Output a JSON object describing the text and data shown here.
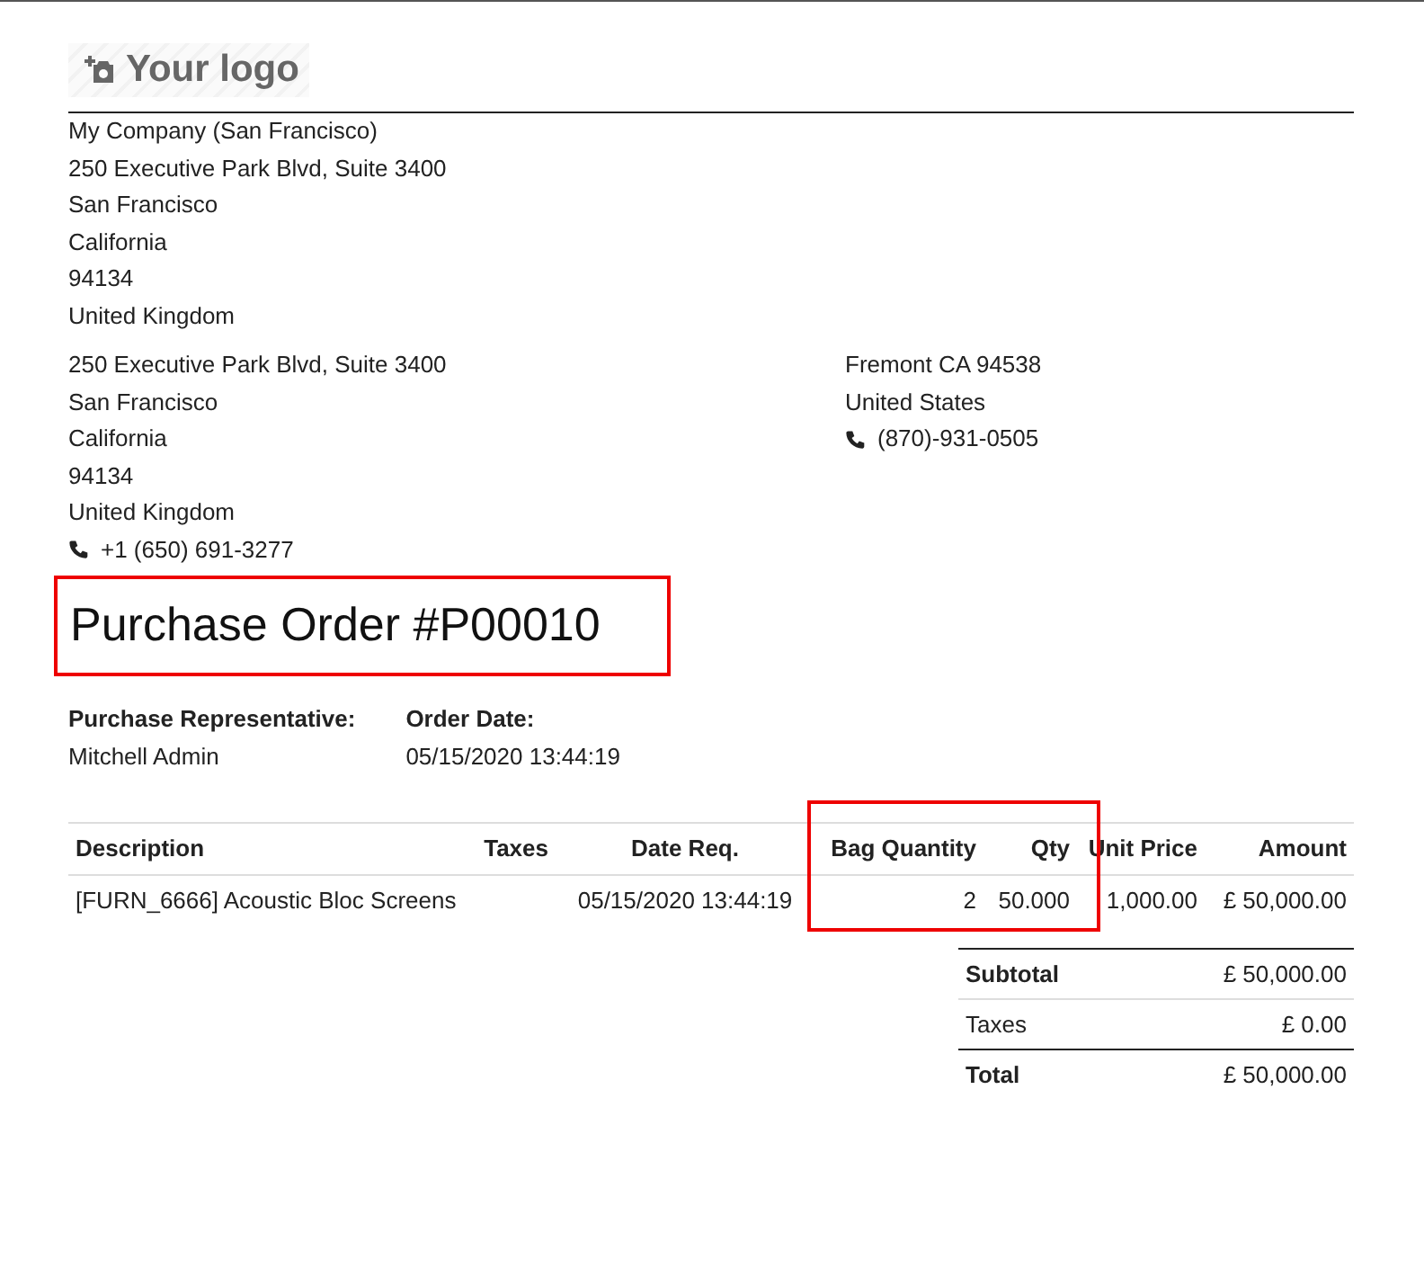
{
  "logo": {
    "text": "Your logo"
  },
  "company": {
    "lines": [
      "My Company (San Francisco)",
      "250 Executive Park Blvd, Suite 3400",
      "San Francisco",
      "California",
      "94134",
      "United Kingdom"
    ]
  },
  "shipping_address": {
    "lines": [
      "250 Executive Park Blvd, Suite 3400",
      "San Francisco",
      "California",
      "94134",
      "United Kingdom"
    ],
    "phone": "+1 (650) 691-3277"
  },
  "vendor_address": {
    "lines": [
      "Fremont CA 94538",
      "United States"
    ],
    "phone": "(870)-931-0505"
  },
  "title": "Purchase Order #P00010",
  "info": [
    {
      "label": "Purchase Representative:",
      "value": "Mitchell Admin"
    },
    {
      "label": "Order Date:",
      "value": "05/15/2020 13:44:19"
    }
  ],
  "table": {
    "columns": [
      "Description",
      "Taxes",
      "Date Req.",
      "Bag Quantity",
      "Qty",
      "Unit Price",
      "Amount"
    ],
    "rows": [
      [
        "[FURN_6666] Acoustic Bloc Screens",
        "",
        "05/15/2020 13:44:19",
        "2",
        "50.000",
        "1,000.00",
        "£ 50,000.00"
      ]
    ]
  },
  "totals": [
    {
      "kind": "subtotal",
      "label": "Subtotal",
      "value": "£ 50,000.00"
    },
    {
      "kind": "tax",
      "label": "Taxes",
      "value": "£ 0.00"
    },
    {
      "kind": "total",
      "label": "Total",
      "value": "£ 50,000.00"
    }
  ]
}
